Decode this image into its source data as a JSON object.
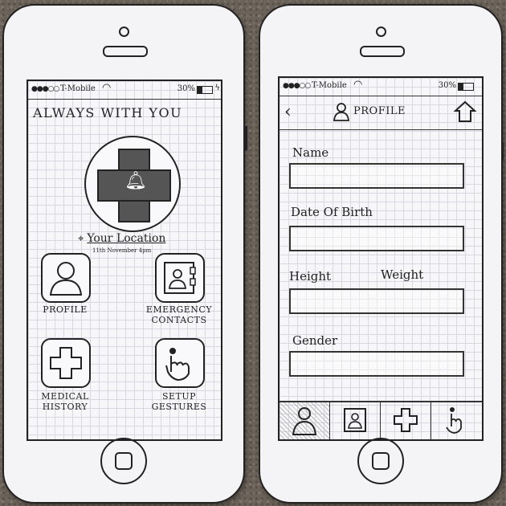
{
  "status_bar": {
    "dots": "●●●○○",
    "carrier": "T-Mobile",
    "battery_left": "30%",
    "battery_right": "30%"
  },
  "home_screen": {
    "title": "ALWAYS WITH YOU",
    "location_label": "Your Location",
    "location_date": "11th November 4pm",
    "tiles": [
      {
        "label": "PROFILE",
        "icon": "person-icon"
      },
      {
        "label": "EMERGENCY CONTACTS",
        "icon": "contact-card-icon"
      },
      {
        "label": "MEDICAL HISTORY",
        "icon": "medical-cross-icon"
      },
      {
        "label": "SETUP GESTURES",
        "icon": "tap-gesture-icon"
      }
    ]
  },
  "profile_screen": {
    "title": "PROFILE",
    "fields": {
      "name": "Name",
      "dob": "Date Of Birth",
      "height": "Height",
      "weight": "Weight",
      "gender": "Gender"
    },
    "tabs": [
      "person-icon",
      "contact-card-icon",
      "medical-cross-icon",
      "tap-gesture-icon"
    ]
  },
  "colors": {
    "ink": "#222222",
    "paper": "#f7f7f9",
    "grid": "#d8d8e0"
  }
}
